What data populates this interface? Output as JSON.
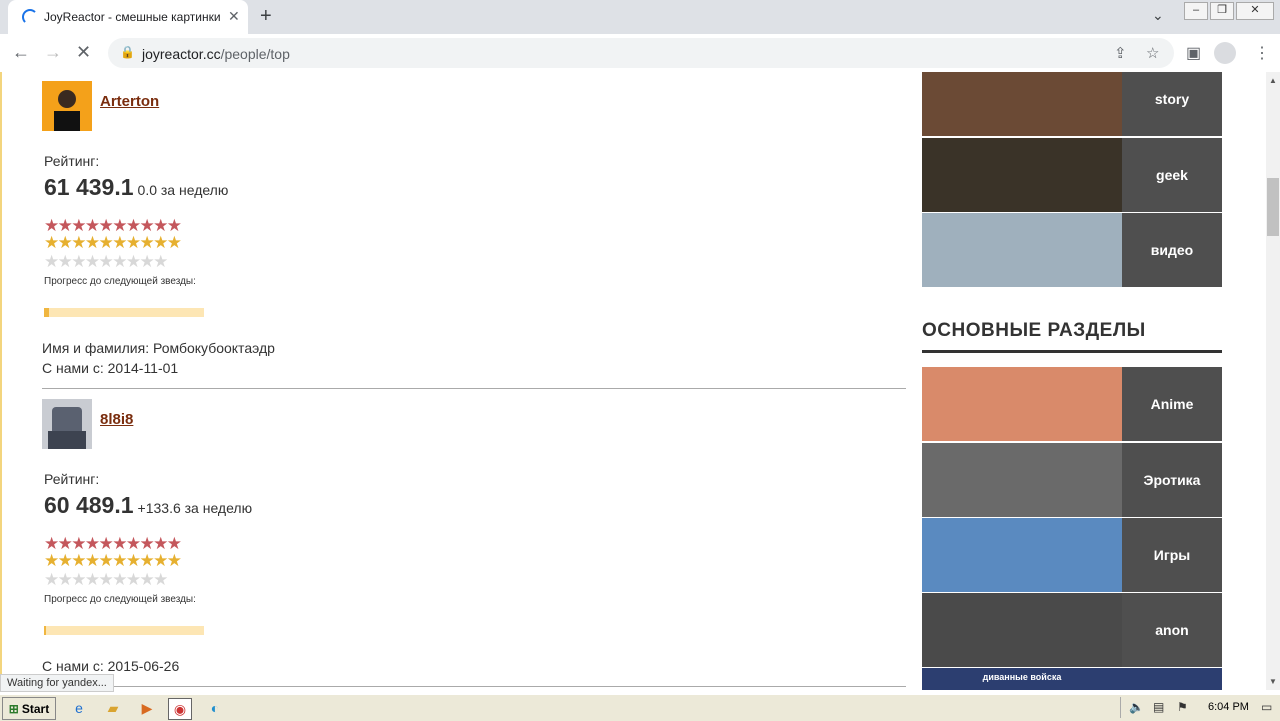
{
  "browser": {
    "tab_title": "JoyReactor - смешные картинки и",
    "tab_close": "✕",
    "new_tab": "+",
    "url_domain": "joyreactor.cc",
    "url_path": "/people/top"
  },
  "users": [
    {
      "name": "Arterton",
      "rating_label": "Рейтинг:",
      "rating_value": "61 439.1",
      "rating_week": "0.0 за неделю",
      "stars_red": "★★★★★★★★★★",
      "stars_gold": "★★★★★★★★★★",
      "stars_grey": "★★★★★★★★★",
      "progress_label": "Прогресс до следующей звезды:",
      "progress_fraction": 0.03,
      "fullname_line": "Имя и фамилия: Ромбокубооктаэдр",
      "since_line": "С нами с: 2014-11-01"
    },
    {
      "name": "8l8i8",
      "rating_label": "Рейтинг:",
      "rating_value": "60 489.1",
      "rating_week": "+133.6 за неделю",
      "stars_red": "★★★★★★★★★★",
      "stars_gold": "★★★★★★★★★★",
      "stars_grey": "★★★★★★★★★",
      "progress_label": "Прогресс до следующей звезды:",
      "progress_fraction": 0.01,
      "since_line": "С нами с: 2015-06-26"
    }
  ],
  "sidebar": {
    "top_items": [
      {
        "label": "story",
        "color": "#6b4a35"
      },
      {
        "label": "geek",
        "color": "#3a3328"
      },
      {
        "label": "видео",
        "color": "#9fb0bd"
      }
    ],
    "section_title": "ОСНОВНЫЕ РАЗДЕЛЫ",
    "sections": [
      {
        "label": "Anime",
        "color": "#d98a6a"
      },
      {
        "label": "Эротика",
        "color": "#6a6a6a"
      },
      {
        "label": "Игры",
        "color": "#5a8ac0"
      },
      {
        "label": "anon",
        "color": "#4a4a4a"
      },
      {
        "label": "диванные войска",
        "color": "#2c3e70"
      }
    ]
  },
  "status_text": "Waiting for yandex...",
  "taskbar": {
    "start_label": "Start",
    "clock": "6:04 PM"
  }
}
